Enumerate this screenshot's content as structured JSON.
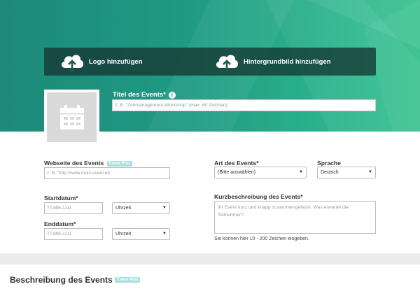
{
  "hero": {
    "logo_label": "Logo hinzufügen",
    "background_label": "Hintergrundbild hinzufügen",
    "title_label": "Titel des Events*",
    "info_symbol": "i",
    "title_placeholder": "z. B. \"Zeitmanagement-Workshop\" (max. 60 Zeichen)"
  },
  "form": {
    "website": {
      "label": "Webseite des Events",
      "badge": "Event Plus",
      "placeholder": "z. B. \"http://www.mein-event.de\""
    },
    "start": {
      "label": "Startdatum*",
      "date_placeholder": "TT.MM.JJJJ",
      "time_value": "Uhrzeit"
    },
    "end": {
      "label": "Enddatum*",
      "date_placeholder": "TT.MM.JJJJ",
      "time_value": "Uhrzeit"
    },
    "type": {
      "label": "Art des Events*",
      "value": "(Bitte auswählen)"
    },
    "language": {
      "label": "Sprache",
      "value": "Deutsch"
    },
    "short_desc": {
      "label": "Kurzbeschreibung des Events*",
      "placeholder": "Ihr Event kurz und knapp zusammengefasst: Was erwartet die Teilnehmer?",
      "hint": "Sie können hier 10 - 200 Zeichen eingeben."
    }
  },
  "description_section": {
    "title": "Beschreibung des Events",
    "badge": "Event Plus"
  },
  "icons": {
    "upload": "cloud-upload-icon",
    "calendar": "calendar-icon",
    "dropdown": "chevron-down-icon"
  },
  "colors": {
    "hero_start": "#1e8a7a",
    "hero_end": "#36c08f",
    "badge": "#a8dfe0"
  }
}
